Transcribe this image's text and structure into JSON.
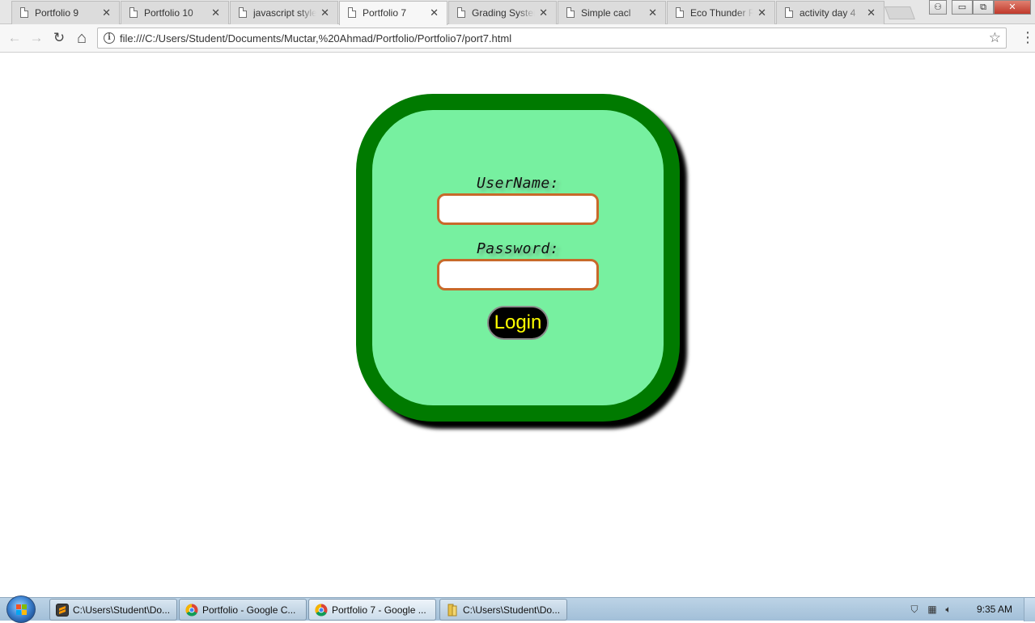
{
  "browser": {
    "tabs": [
      {
        "title": "Portfolio 9",
        "close": "✕"
      },
      {
        "title": "Portfolio 10",
        "close": "✕"
      },
      {
        "title": "javascript style",
        "close": "✕"
      },
      {
        "title": "Portfolio 7",
        "close": "✕"
      },
      {
        "title": "Grading System",
        "close": "✕"
      },
      {
        "title": "Simple cacl",
        "close": "✕"
      },
      {
        "title": "Eco Thunder F",
        "close": "✕"
      },
      {
        "title": "activity day 4",
        "close": "✕"
      }
    ],
    "active_tab_index": 3,
    "url": "file:///C:/Users/Student/Documents/Muctar,%20Ahmad/Portfolio/Portfolio7/port7.html",
    "nav": {
      "back": "←",
      "forward": "→",
      "reload": "↻",
      "home": "⌂",
      "info": "i",
      "star": "☆",
      "menu": "⋮"
    },
    "window_controls": {
      "user": "⚇",
      "minimize": "▭",
      "restore": "⧉",
      "close": "✕"
    }
  },
  "page": {
    "username_label": "UserName:",
    "password_label": "Password:",
    "username_value": "",
    "password_value": "",
    "login_label": "Login",
    "colors": {
      "box_fill": "#77f0a0",
      "box_border": "#007a00",
      "input_border": "#c8692a",
      "button_bg": "#000000",
      "button_text": "#ffff00"
    }
  },
  "taskbar": {
    "items": [
      {
        "label": "C:\\Users\\Student\\Do...",
        "icon": "sublime-icon"
      },
      {
        "label": "Portfolio - Google C...",
        "icon": "chrome-icon"
      },
      {
        "label": "Portfolio 7 - Google ...",
        "icon": "chrome-icon"
      },
      {
        "label": "C:\\Users\\Student\\Do...",
        "icon": "folder-icon"
      }
    ],
    "clock": "9:35 AM"
  }
}
